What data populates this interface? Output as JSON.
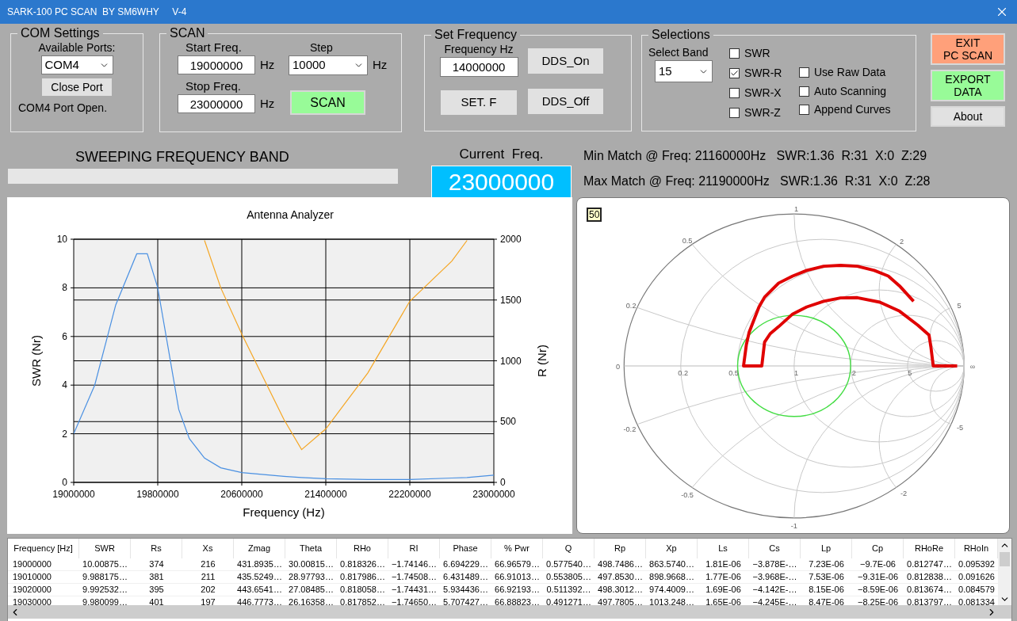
{
  "window": {
    "title": "SARK-100 PC SCAN  BY SM6WHY     V-4"
  },
  "com_settings": {
    "title": "COM Settings",
    "ports_label": "Available Ports:",
    "port": "COM4",
    "close_button": "Close Port",
    "status": "COM4 Port Open."
  },
  "scan": {
    "title": "SCAN",
    "start_label": "Start Freq.",
    "start": "19000000",
    "start_unit": "Hz",
    "step_label": "Step",
    "step": "10000",
    "step_unit": "Hz",
    "stop_label": "Stop Freq.",
    "stop": "23000000",
    "stop_unit": "Hz",
    "scan_button": "SCAN"
  },
  "set_frequency": {
    "title": "Set Frequency",
    "freq_label": "Frequency Hz",
    "freq": "14000000",
    "set_button": "SET. F",
    "dds_on_button": "DDS_On",
    "dds_off_button": "DDS_Off"
  },
  "selections": {
    "title": "Selections",
    "band_label": "Select Band",
    "band": "15",
    "plots": [
      {
        "label": "SWR",
        "checked": false
      },
      {
        "label": "SWR-R",
        "checked": true
      },
      {
        "label": "SWR-X",
        "checked": false
      },
      {
        "label": "SWR-Z",
        "checked": false
      }
    ],
    "options": [
      {
        "label": "Use Raw Data",
        "checked": false
      },
      {
        "label": "Auto Scanning",
        "checked": false
      },
      {
        "label": "Append Curves",
        "checked": false
      }
    ]
  },
  "actions": [
    {
      "kind": "exit",
      "lines": [
        "EXIT",
        "PC SCAN"
      ]
    },
    {
      "kind": "export",
      "lines": [
        "EXPORT",
        "DATA"
      ]
    },
    {
      "kind": "plain",
      "lines": [
        "About"
      ]
    }
  ],
  "sweep": {
    "label": "SWEEPING FREQUENCY BAND",
    "level": 0
  },
  "current": {
    "label": "Current  Freq.",
    "value": "23000000"
  },
  "matches": [
    "Min Match @ Freq: 21160000Hz   SWR:1.36  R:31  X:0  Z:29",
    "Max Match @ Freq: 21190000Hz   SWR:1.36  R:31  X:0  Z:28"
  ],
  "chart": {
    "chart_data": {
      "type": "line",
      "grid": true,
      "title": "Antenna Analyzer",
      "xlabel": "Frequency (Hz)",
      "ylabel": "SWR (Nr)",
      "y2label": "R (Nr)",
      "x": [
        19000000,
        19200000,
        19400000,
        19600000,
        19700000,
        19800000,
        19900000,
        20000000,
        20100000,
        20245000,
        20400000,
        20600000,
        21000000,
        21170000,
        21400000,
        21800000,
        22200000,
        22600000,
        22745000,
        23000000
      ],
      "series": [
        {
          "color": "#4a90e2",
          "values": [
            2.0,
            4.0,
            7.3,
            9.4,
            9.4,
            8.0,
            5.5,
            3.0,
            1.8,
            1.0,
            0.6,
            0.4,
            0.25,
            0.2,
            0.15,
            0.12,
            0.12,
            0.18,
            0.2,
            0.3
          ]
        },
        {
          "color": "#f5a623",
          "axis": "y2",
          "values": [
            null,
            null,
            null,
            null,
            null,
            null,
            null,
            null,
            null,
            1990,
            1600,
            1220,
            520,
            270,
            440,
            900,
            1490,
            1820,
            1990,
            null
          ]
        }
      ],
      "xlim": [
        19000000,
        23000000
      ],
      "ylim": [
        0,
        10
      ],
      "y2lim": [
        0,
        2000
      ],
      "xticks": [
        {
          "value": 19000000,
          "label": "19000000"
        },
        {
          "value": 19800000,
          "label": "19800000"
        },
        {
          "value": 20600000,
          "label": "20600000"
        },
        {
          "value": 21400000,
          "label": "21400000"
        },
        {
          "value": 22200000,
          "label": "22200000"
        },
        {
          "value": 23000000,
          "label": "23000000"
        }
      ],
      "yticks": [
        0,
        2,
        4,
        6,
        8,
        10
      ],
      "y2ticks": [
        0,
        500,
        1000,
        1500,
        2000
      ]
    }
  },
  "smith_chart": {
    "badge": "50",
    "labels": [
      "1",
      "0.5",
      "2",
      "0.2",
      "5",
      "0",
      "0.2",
      "0.5",
      "1",
      "2",
      "5",
      "∞",
      "-0.2",
      "-0.5",
      "-2",
      "-5",
      "-1"
    ]
  },
  "table": {
    "columns": [
      "Frequency [Hz]",
      "SWR",
      "Rs",
      "Xs",
      "Zmag",
      "Theta",
      "RHo",
      "RI",
      "Phase",
      "% Pwr",
      "Q",
      "Rp",
      "Xp",
      "Ls",
      "Cs",
      "Lp",
      "Cp",
      "RHoRe",
      "RHoIn"
    ],
    "rows": [
      [
        "19000000",
        "10.00875…",
        "374",
        "216",
        "431.8935…",
        "30.00815…",
        "0.818326…",
        "−1.74146…",
        "6.694229…",
        "66.96579…",
        "0.577540…",
        "498.7486…",
        "863.5740…",
        "1.81E-06",
        "−3.878E-…",
        "7.23E-06",
        "−9.7E-06",
        "0.812747…",
        "0.095392"
      ],
      [
        "19010000",
        "9.988175…",
        "381",
        "211",
        "435.5249…",
        "28.97793…",
        "0.817986…",
        "−1.74508…",
        "6.431489…",
        "66.91013…",
        "0.553805…",
        "497.8530…",
        "898.9668…",
        "1.77E-06",
        "−3.968E-…",
        "7.53E-06",
        "−9.31E-06",
        "0.812838…",
        "0.091626"
      ],
      [
        "19020000",
        "9.992532…",
        "395",
        "202",
        "443.6541…",
        "27.08485…",
        "0.818058…",
        "−1.74431…",
        "5.934436…",
        "66.92193…",
        "0.511392…",
        "498.3012…",
        "974.4009…",
        "1.69E-06",
        "−4.142E-…",
        "8.15E-06",
        "−8.59E-06",
        "0.813674…",
        "0.084579"
      ],
      [
        "19030000",
        "9.980099…",
        "401",
        "197",
        "446.7773…",
        "26.16358…",
        "0.817852…",
        "−1.74650…",
        "5.707427…",
        "66.88823…",
        "0.491271…",
        "497.7805…",
        "1013.248…",
        "1.65E-06",
        "−4.245E-…",
        "8.47E-06",
        "−8.25E-06",
        "0.813797…",
        "0.081334"
      ]
    ]
  }
}
